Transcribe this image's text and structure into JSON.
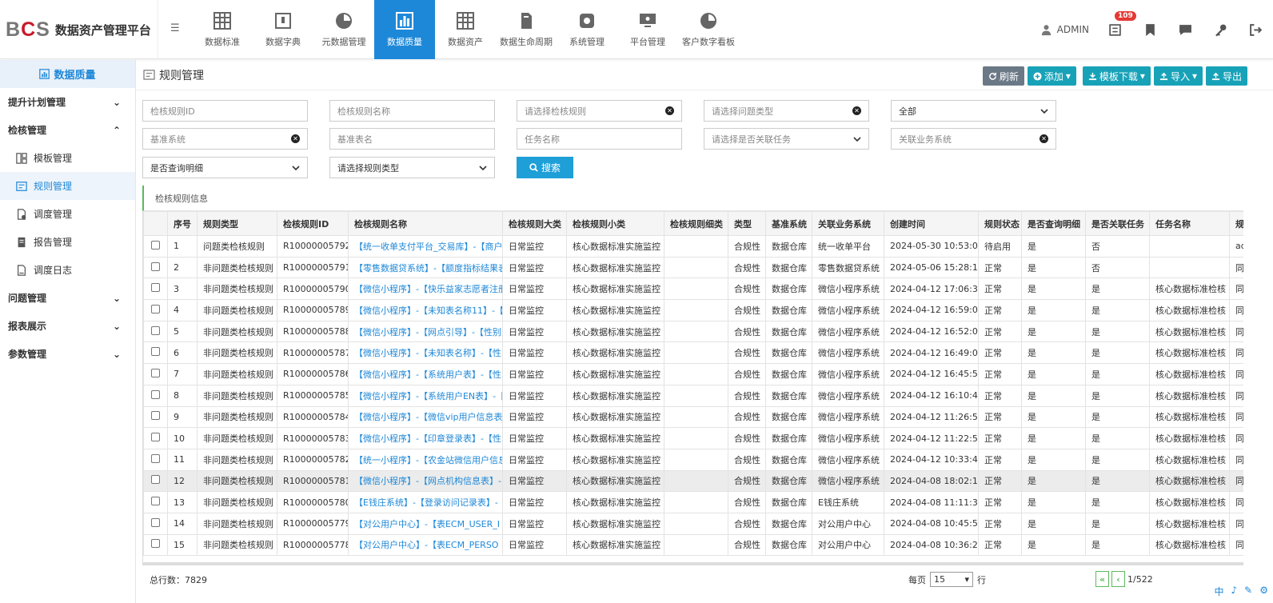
{
  "brand": {
    "logo_b": "B",
    "logo_c": "C",
    "logo_s": "S",
    "name": "数据资产管理平台"
  },
  "nav": [
    {
      "label": "数据标准",
      "icon": "grid-icon"
    },
    {
      "label": "数据字典",
      "icon": "book-icon"
    },
    {
      "label": "元数据管理",
      "icon": "pie-icon"
    },
    {
      "label": "数据质量",
      "icon": "bar-chart-icon",
      "active": true
    },
    {
      "label": "数据资产",
      "icon": "grid-icon"
    },
    {
      "label": "数据生命周期",
      "icon": "document-icon"
    },
    {
      "label": "系统管理",
      "icon": "gear-icon"
    },
    {
      "label": "平台管理",
      "icon": "monitor-icon"
    },
    {
      "label": "客户数字看板",
      "icon": "pie-icon"
    }
  ],
  "header": {
    "user": "ADMIN",
    "badge": "109"
  },
  "sidebar": {
    "title": "数据质量",
    "group1": "提升计划管理",
    "group2": "检核管理",
    "items": [
      "模板管理",
      "规则管理",
      "调度管理",
      "报告管理",
      "调度日志"
    ],
    "group3": "问题管理",
    "group4": "报表展示",
    "group5": "参数管理"
  },
  "page": {
    "title": "规则管理",
    "refresh": "刷新",
    "add": "添加",
    "template_download": "模板下载",
    "import": "导入",
    "export": "导出"
  },
  "filters": {
    "rule_id": "检核规则ID",
    "rule_name": "检核规则名称",
    "select_rule": "请选择检核规则",
    "select_problem_type": "请选择问题类型",
    "all": "全部",
    "base_system": "基准系统",
    "base_table": "基准表名",
    "task_name": "任务名称",
    "select_linked_task": "请选择是否关联任务",
    "linked_system": "关联业务系统",
    "query_detail": "是否查询明细",
    "select_rule_type": "请选择规则类型",
    "search": "搜索"
  },
  "section_title": "检核规则信息",
  "table": {
    "columns": [
      "序号",
      "规则类型",
      "检核规则ID",
      "检核规则名称",
      "检核规则大类",
      "检核规则小类",
      "检核规则细类",
      "类型",
      "基准系统",
      "关联业务系统",
      "创建时间",
      "规则状态",
      "是否查询明细",
      "是否关联任务",
      "任务名称",
      "规"
    ],
    "rows": [
      [
        "1",
        "问题类检核规则",
        "R10000005792",
        "【统一收单支付平台_交易库】-【商户",
        "日常监控",
        "核心数据标准实施监控",
        "",
        "合规性",
        "数据仓库",
        "统一收单平台",
        "2024-05-30 10:53:01",
        "待启用",
        "是",
        "否",
        "",
        "ad"
      ],
      [
        "2",
        "非问题类检核规则",
        "R10000005791",
        "【零售数据贷系统】-【额度指标结果表",
        "日常监控",
        "核心数据标准实施监控",
        "",
        "合规性",
        "数据仓库",
        "零售数据贷系统",
        "2024-05-06 15:28:19",
        "正常",
        "是",
        "否",
        "",
        "同"
      ],
      [
        "3",
        "非问题类检核规则",
        "R10000005790",
        "【微信小程序】-【快乐益家志愿者注册",
        "日常监控",
        "核心数据标准实施监控",
        "",
        "合规性",
        "数据仓库",
        "微信小程序系统",
        "2024-04-12 17:06:39",
        "正常",
        "是",
        "是",
        "核心数据标准检核",
        "同"
      ],
      [
        "4",
        "非问题类检核规则",
        "R10000005789",
        "【微信小程序】-【未知表名称11】-【",
        "日常监控",
        "核心数据标准实施监控",
        "",
        "合规性",
        "数据仓库",
        "微信小程序系统",
        "2024-04-12 16:59:02",
        "正常",
        "是",
        "是",
        "核心数据标准检核",
        "同"
      ],
      [
        "5",
        "非问题类检核规则",
        "R10000005788",
        "【微信小程序】-【网点引导】-【性别",
        "日常监控",
        "核心数据标准实施监控",
        "",
        "合规性",
        "数据仓库",
        "微信小程序系统",
        "2024-04-12 16:52:00",
        "正常",
        "是",
        "是",
        "核心数据标准检核",
        "同"
      ],
      [
        "6",
        "非问题类检核规则",
        "R10000005787",
        "【微信小程序】-【未知表名称】-【性",
        "日常监控",
        "核心数据标准实施监控",
        "",
        "合规性",
        "数据仓库",
        "微信小程序系统",
        "2024-04-12 16:49:02",
        "正常",
        "是",
        "是",
        "核心数据标准检核",
        "同"
      ],
      [
        "7",
        "非问题类检核规则",
        "R10000005786",
        "【微信小程序】-【系统用户表】-【性",
        "日常监控",
        "核心数据标准实施监控",
        "",
        "合规性",
        "数据仓库",
        "微信小程序系统",
        "2024-04-12 16:45:57",
        "正常",
        "是",
        "是",
        "核心数据标准检核",
        "同"
      ],
      [
        "8",
        "非问题类检核规则",
        "R10000005785",
        "【微信小程序】-【系统用户EN表】-【",
        "日常监控",
        "核心数据标准实施监控",
        "",
        "合规性",
        "数据仓库",
        "微信小程序系统",
        "2024-04-12 16:10:45",
        "正常",
        "是",
        "是",
        "核心数据标准检核",
        "同"
      ],
      [
        "9",
        "非问题类检核规则",
        "R10000005784",
        "【微信小程序】-【微信vip用户信息表",
        "日常监控",
        "核心数据标准实施监控",
        "",
        "合规性",
        "数据仓库",
        "微信小程序系统",
        "2024-04-12 11:26:51",
        "正常",
        "是",
        "是",
        "核心数据标准检核",
        "同"
      ],
      [
        "10",
        "非问题类检核规则",
        "R10000005783",
        "【微信小程序】-【印章登录表】-【性",
        "日常监控",
        "核心数据标准实施监控",
        "",
        "合规性",
        "数据仓库",
        "微信小程序系统",
        "2024-04-12 11:22:51",
        "正常",
        "是",
        "是",
        "核心数据标准检核",
        "同"
      ],
      [
        "11",
        "非问题类检核规则",
        "R10000005782",
        "【统一小程序】-【农金站微信用户信息",
        "日常监控",
        "核心数据标准实施监控",
        "",
        "合规性",
        "数据仓库",
        "微信小程序系统",
        "2024-04-12 10:33:45",
        "正常",
        "是",
        "是",
        "核心数据标准检核",
        "同"
      ],
      [
        "12",
        "非问题类检核规则",
        "R10000005781",
        "【微信小程序】-【网点机构信息表】-",
        "日常监控",
        "核心数据标准实施监控",
        "",
        "合规性",
        "数据仓库",
        "微信小程序系统",
        "2024-04-08 18:02:11",
        "正常",
        "是",
        "是",
        "核心数据标准检核",
        "同"
      ],
      [
        "13",
        "非问题类检核规则",
        "R10000005780",
        "【E钱庄系统】-【登录访问记录表】-",
        "日常监控",
        "核心数据标准实施监控",
        "",
        "合规性",
        "数据仓库",
        "E钱庄系统",
        "2024-04-08 11:11:38",
        "正常",
        "是",
        "是",
        "核心数据标准检核",
        "同"
      ],
      [
        "14",
        "非问题类检核规则",
        "R10000005779",
        "【对公用户中心】-【表ECM_USER_I",
        "日常监控",
        "核心数据标准实施监控",
        "",
        "合规性",
        "数据仓库",
        "对公用户中心",
        "2024-04-08 10:45:57",
        "正常",
        "是",
        "是",
        "核心数据标准检核",
        "同"
      ],
      [
        "15",
        "非问题类检核规则",
        "R10000005778",
        "【对公用户中心】-【表ECM_PERSO",
        "日常监控",
        "核心数据标准实施监控",
        "",
        "合规性",
        "数据仓库",
        "对公用户中心",
        "2024-04-08 10:36:23",
        "正常",
        "是",
        "是",
        "核心数据标准检核",
        "同"
      ]
    ]
  },
  "footer": {
    "total": "总行数：7829",
    "per_page_label": "每页",
    "per_page_value": "15",
    "row_label": "行",
    "first": "«",
    "prev": "‹",
    "page_info": "1/522"
  },
  "corner": [
    "中",
    "♪",
    "✎",
    "⚙"
  ]
}
